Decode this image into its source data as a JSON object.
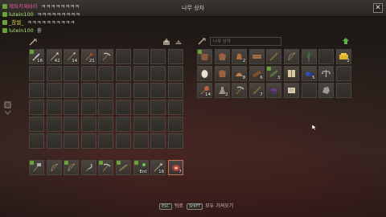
{
  "window": {
    "title": "나무 상자",
    "close_label": "✕"
  },
  "chat": [
    {
      "name": "헤파카제바라",
      "name_color": "#e05a9a",
      "badge": "#6aa33a",
      "msg": "ㅋㅋㅋㅋㅋㅋㅋㅋ"
    },
    {
      "name": "lutein100",
      "name_color": "#a8e078",
      "badge": "#6aa33a",
      "msg": "ㅋㅋㅋㅋㅋㅋㅋㅋㅋ"
    },
    {
      "name": "_참썰_",
      "name_color": "#e8d050",
      "badge": "#6aa33a",
      "msg": "ㅋㅋㅋㅋㅋㅋㅋㅋㅋㅋ"
    },
    {
      "name": "lutein100",
      "name_color": "#a8e078",
      "badge": "#6aa33a",
      "msg": "휴"
    }
  ],
  "search": {
    "placeholder": "나무 상자"
  },
  "inventory": {
    "rows": [
      [
        {
          "icon": "sword-icon",
          "count": "16",
          "level": true
        },
        {
          "icon": "arrow-icon",
          "count": "42"
        },
        {
          "icon": "spear-icon",
          "count": "14"
        },
        {
          "icon": "axe-icon",
          "count": "21"
        },
        {
          "icon": "pickaxe-icon",
          "count": ""
        },
        {
          "icon": "",
          "count": ""
        },
        {
          "icon": "",
          "count": ""
        },
        {
          "icon": "",
          "count": ""
        },
        {
          "icon": "",
          "count": ""
        }
      ],
      [
        {},
        {},
        {},
        {},
        {},
        {},
        {},
        {},
        {}
      ],
      [
        {},
        {},
        {},
        {},
        {},
        {},
        {},
        {},
        {}
      ],
      [
        {},
        {},
        {},
        {},
        {},
        {},
        {},
        {},
        {}
      ],
      [
        {},
        {},
        {},
        {},
        {},
        {},
        {},
        {},
        {}
      ],
      [
        {},
        {},
        {},
        {},
        {},
        {},
        {},
        {},
        {}
      ]
    ]
  },
  "hotbar": [
    {
      "icon": "hammer-icon",
      "count": "",
      "level": true
    },
    {
      "icon": "bow-icon",
      "count": ""
    },
    {
      "icon": "bow-icon",
      "count": "",
      "level": true
    },
    {
      "icon": "sickle-icon",
      "count": ""
    },
    {
      "icon": "pickaxe-icon",
      "count": "",
      "level": true
    },
    {
      "icon": "rope-icon",
      "count": "",
      "level": true
    },
    {
      "icon": "potion-icon",
      "count": "Ent",
      "level": true
    },
    {
      "icon": "arrow-icon",
      "count": "16"
    },
    {
      "icon": "meat-icon",
      "count": "7",
      "selected": true
    }
  ],
  "chest": {
    "rows": [
      [
        {
          "icon": "leather-icon",
          "count": "",
          "level": true
        },
        {
          "icon": "hide-icon",
          "count": ""
        },
        {
          "icon": "bell-icon",
          "count": "2"
        },
        {
          "icon": "plank-icon",
          "count": ""
        },
        {
          "icon": "stick-icon",
          "count": ""
        },
        {
          "icon": "bow-icon",
          "count": ""
        },
        {
          "icon": "vine-icon",
          "count": ""
        },
        {
          "icon": "",
          "count": ""
        },
        {
          "icon": "gold-icon",
          "count": "2"
        }
      ],
      [
        {
          "icon": "egg-icon",
          "count": ""
        },
        {
          "icon": "hide-icon",
          "count": ""
        },
        {
          "icon": "shell-icon",
          "count": "8"
        },
        {
          "icon": "wood-icon",
          "count": "6"
        },
        {
          "icon": "bundle-icon",
          "count": "3",
          "level": true
        },
        {
          "icon": "book-icon",
          "count": ""
        },
        {
          "icon": "berry-icon",
          "count": "5"
        },
        {
          "icon": "scale-icon",
          "count": ""
        },
        {
          "icon": "",
          "count": ""
        }
      ],
      [
        {
          "icon": "mace-icon",
          "count": "14"
        },
        {
          "icon": "flask-icon",
          "count": "2"
        },
        {
          "icon": "pickaxe-icon",
          "count": ""
        },
        {
          "icon": "stick-icon",
          "count": "7"
        },
        {
          "icon": "grape-icon",
          "count": ""
        },
        {
          "icon": "scroll-icon",
          "count": ""
        },
        {
          "icon": "",
          "count": ""
        },
        {
          "icon": "stone-icon",
          "count": ""
        },
        {
          "icon": "",
          "count": ""
        }
      ]
    ]
  },
  "footer": {
    "back_key": "ESC",
    "back_label": "뒤로",
    "take_all_key": "SHIFT",
    "take_all_label": "모두 가져오기"
  },
  "colors": {
    "accent_green": "#6aa33a",
    "selected_border": "#c87050"
  }
}
